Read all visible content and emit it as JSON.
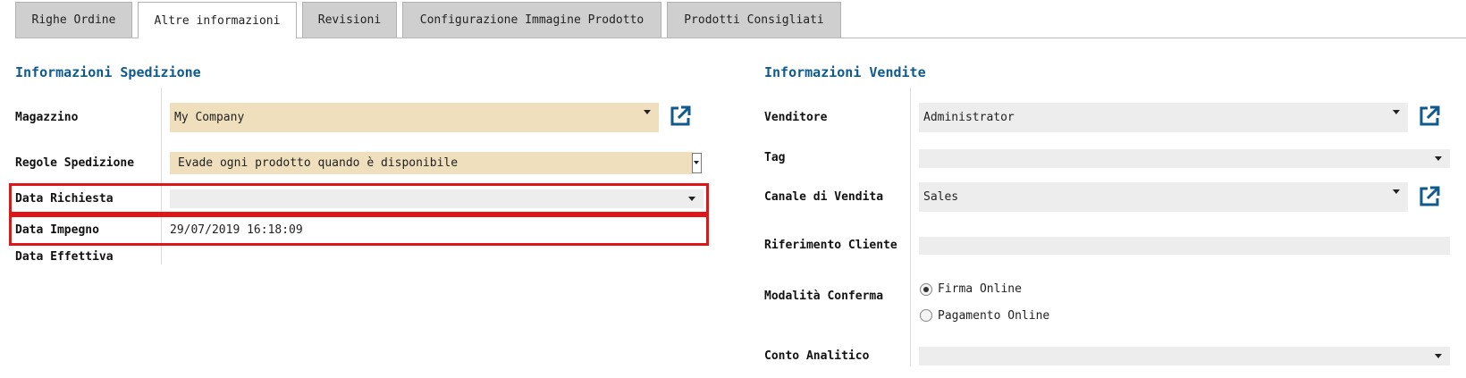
{
  "tabs": [
    {
      "label": "Righe Ordine",
      "active": false
    },
    {
      "label": "Altre informazioni",
      "active": true
    },
    {
      "label": "Revisioni",
      "active": false
    },
    {
      "label": "Configurazione Immagine Prodotto",
      "active": false
    },
    {
      "label": "Prodotti Consigliati",
      "active": false
    }
  ],
  "shipping": {
    "title": "Informazioni Spedizione",
    "magazzino": {
      "label": "Magazzino",
      "value": "My Company"
    },
    "regole": {
      "label": "Regole Spedizione",
      "value": "Evade ogni prodotto quando è disponibile"
    },
    "data_richiesta": {
      "label": "Data Richiesta",
      "value": ""
    },
    "data_impegno": {
      "label": "Data Impegno",
      "value": "29/07/2019 16:18:09"
    },
    "data_effettiva": {
      "label": "Data Effettiva",
      "value": ""
    }
  },
  "sales": {
    "title": "Informazioni Vendite",
    "venditore": {
      "label": "Venditore",
      "value": "Administrator"
    },
    "tag": {
      "label": "Tag",
      "value": ""
    },
    "canale": {
      "label": "Canale di Vendita",
      "value": "Sales"
    },
    "riferimento": {
      "label": "Riferimento Cliente",
      "value": ""
    },
    "modalita": {
      "label": "Modalità Conferma",
      "options": [
        "Firma Online",
        "Pagamento Online"
      ],
      "selected": "Firma Online"
    },
    "conto": {
      "label": "Conto Analitico",
      "value": ""
    }
  },
  "colors": {
    "accent": "#0e5a8c",
    "required_bg": "#efdfbd",
    "highlight": "#e01515"
  }
}
